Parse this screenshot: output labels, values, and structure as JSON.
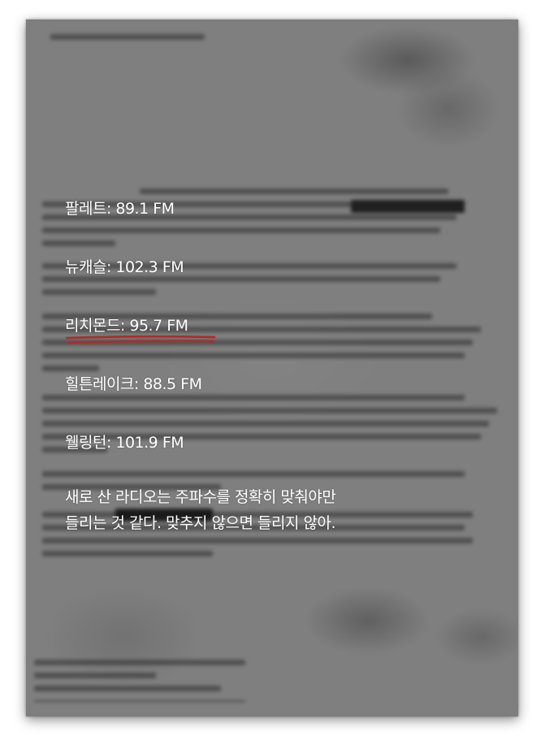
{
  "stations": [
    {
      "label": "팔레트: 89.1 FM"
    },
    {
      "label": "뉴캐슬: 102.3 FM"
    },
    {
      "label": "리치몬드: 95.7 FM"
    },
    {
      "label": "힐튼레이크: 88.5 FM"
    },
    {
      "label": "웰링턴: 101.9 FM"
    }
  ],
  "caption": {
    "line1": "새로 산 라디오는 주파수를 정확히 맞춰야만",
    "line2": "들리는 것 같다. 맞추지 않으면 들리지 않아."
  },
  "colors": {
    "text": "#ffffff",
    "underline": "#b02a2a",
    "background": "#7f7f7f"
  }
}
